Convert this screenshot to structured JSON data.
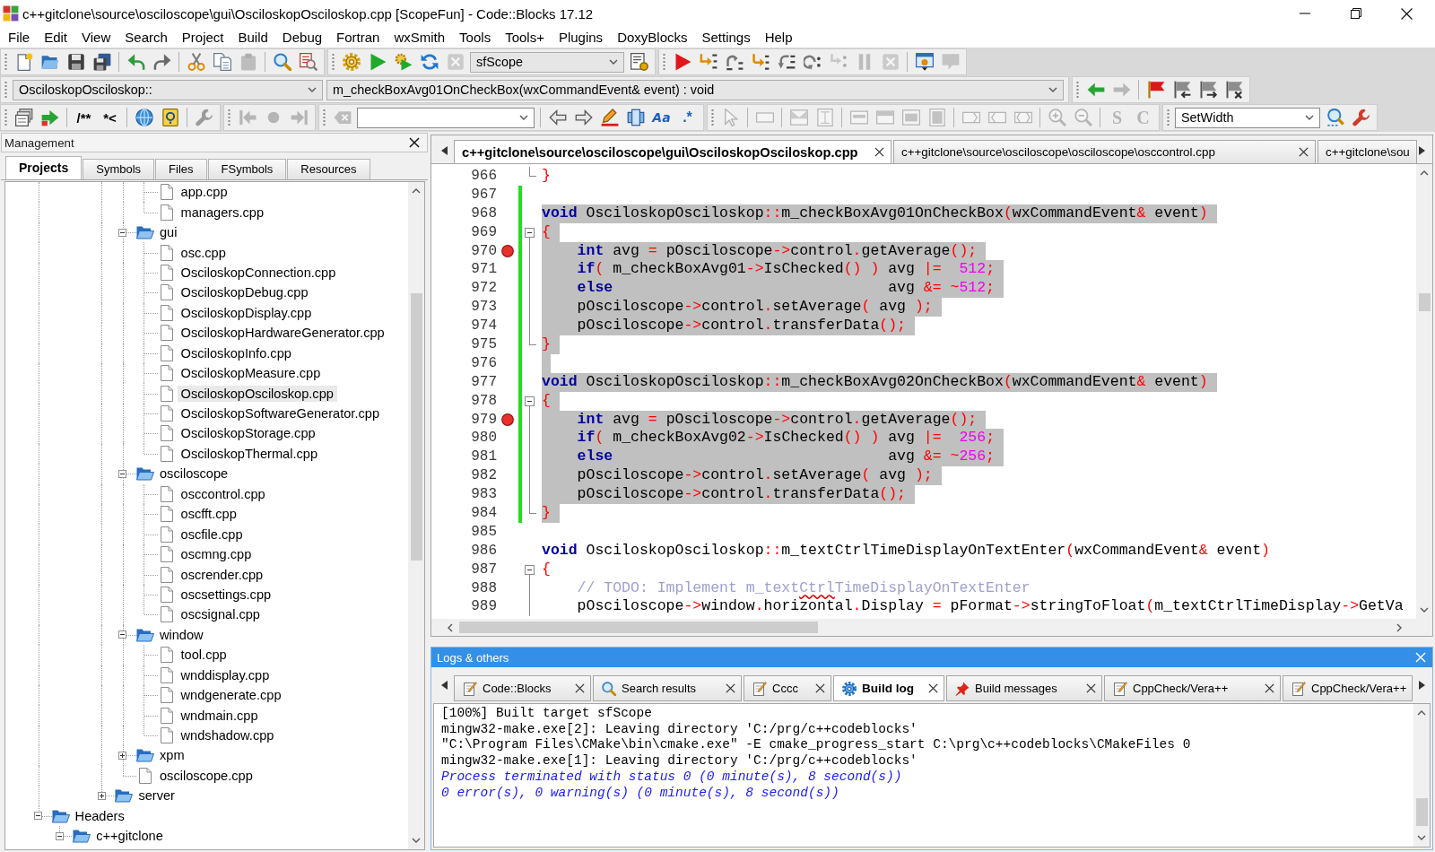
{
  "window": {
    "title": "c++gitclone\\source\\osciloscope\\gui\\OsciloskopOsciloskop.cpp [ScopeFun] - Code::Blocks 17.12"
  },
  "menu": [
    "File",
    "Edit",
    "View",
    "Search",
    "Project",
    "Build",
    "Debug",
    "Fortran",
    "wxSmith",
    "Tools",
    "Tools+",
    "Plugins",
    "DoxyBlocks",
    "Settings",
    "Help"
  ],
  "toolbar_rows": [
    {
      "toolbars": [
        {
          "items": [
            {
              "kind": "icon",
              "disabled": false
            },
            {
              "kind": "icon",
              "disabled": false
            },
            {
              "kind": "icon",
              "disabled": false
            },
            {
              "kind": "icon",
              "disabled": false
            },
            {
              "kind": "separator"
            },
            {
              "kind": "icon",
              "disabled": false
            },
            {
              "kind": "icon",
              "disabled": false
            },
            {
              "kind": "separator"
            },
            {
              "kind": "icon",
              "disabled": false
            },
            {
              "kind": "icon",
              "disabled": false
            },
            {
              "kind": "icon",
              "disabled": true
            },
            {
              "kind": "separator"
            },
            {
              "kind": "icon",
              "disabled": false
            },
            {
              "kind": "icon",
              "disabled": false
            }
          ]
        },
        {
          "items": [
            {
              "kind": "icon",
              "disabled": false
            },
            {
              "kind": "icon",
              "disabled": false
            },
            {
              "kind": "icon",
              "disabled": false
            },
            {
              "kind": "icon",
              "disabled": false
            },
            {
              "kind": "icon",
              "disabled": true
            },
            {
              "kind": "dropdown",
              "value": "sfScope",
              "disabled": false
            },
            {
              "kind": "icon",
              "disabled": false
            }
          ]
        },
        {
          "items": [
            {
              "kind": "icon",
              "disabled": false
            },
            {
              "kind": "icon",
              "disabled": false
            },
            {
              "kind": "icon",
              "disabled": false
            },
            {
              "kind": "icon",
              "disabled": false
            },
            {
              "kind": "icon",
              "disabled": false
            },
            {
              "kind": "icon",
              "disabled": false
            },
            {
              "kind": "icon",
              "disabled": true
            },
            {
              "kind": "icon",
              "disabled": true
            },
            {
              "kind": "icon",
              "disabled": true
            },
            {
              "kind": "separator"
            },
            {
              "kind": "icon",
              "disabled": false
            },
            {
              "kind": "icon",
              "disabled": true
            }
          ]
        }
      ]
    },
    {
      "toolbars": [
        {
          "items": [
            {
              "kind": "dropdown",
              "value": "OsciloskopOsciloskop::",
              "disabled": false
            },
            {
              "kind": "dropdown",
              "value": "m_checkBoxAvg01OnCheckBox(wxCommandEvent& event) : void",
              "disabled": false
            }
          ]
        },
        {
          "items": [
            {
              "kind": "icon",
              "disabled": false
            },
            {
              "kind": "icon",
              "disabled": true
            },
            {
              "kind": "separator"
            },
            {
              "kind": "icon",
              "disabled": false
            },
            {
              "kind": "icon",
              "disabled": false
            },
            {
              "kind": "icon",
              "disabled": false
            },
            {
              "kind": "icon",
              "disabled": false
            }
          ]
        }
      ]
    },
    {
      "toolbars": [
        {
          "items": [
            {
              "kind": "icon",
              "disabled": false
            },
            {
              "kind": "icon",
              "disabled": false
            },
            {
              "kind": "separator"
            },
            {
              "kind": "label",
              "text": "/**",
              "disabled": false
            },
            {
              "kind": "label",
              "text": "*<",
              "disabled": false
            },
            {
              "kind": "separator"
            },
            {
              "kind": "icon",
              "disabled": false
            },
            {
              "kind": "icon",
              "disabled": false
            },
            {
              "kind": "separator"
            },
            {
              "kind": "icon",
              "disabled": false
            }
          ]
        },
        {
          "items": [
            {
              "kind": "icon",
              "disabled": true
            },
            {
              "kind": "icon",
              "disabled": true
            },
            {
              "kind": "icon",
              "disabled": true
            }
          ]
        },
        {
          "items": [
            {
              "kind": "icon",
              "disabled": true
            },
            {
              "kind": "combo",
              "disabled": false
            },
            {
              "kind": "separator"
            },
            {
              "kind": "icon",
              "disabled": false
            },
            {
              "kind": "icon",
              "disabled": false
            },
            {
              "kind": "icon",
              "disabled": false
            },
            {
              "kind": "icon",
              "disabled": false
            },
            {
              "kind": "label",
              "text": "Aa",
              "disabled": false
            },
            {
              "kind": "label",
              "text": ".*",
              "disabled": false
            }
          ]
        },
        {
          "items": [
            {
              "kind": "icon",
              "disabled": true
            },
            {
              "kind": "separator"
            },
            {
              "kind": "icon",
              "disabled": true
            },
            {
              "kind": "separator"
            },
            {
              "kind": "icon",
              "disabled": true
            },
            {
              "kind": "icon",
              "disabled": true
            },
            {
              "kind": "separator"
            },
            {
              "kind": "icon",
              "disabled": true
            },
            {
              "kind": "icon",
              "disabled": true
            },
            {
              "kind": "icon",
              "disabled": true
            },
            {
              "kind": "icon",
              "disabled": true
            },
            {
              "kind": "separator"
            },
            {
              "kind": "icon",
              "disabled": true
            },
            {
              "kind": "icon",
              "disabled": true
            },
            {
              "kind": "icon",
              "disabled": true
            },
            {
              "kind": "separator"
            },
            {
              "kind": "icon",
              "disabled": true
            },
            {
              "kind": "icon",
              "disabled": true
            },
            {
              "kind": "separator"
            },
            {
              "kind": "label",
              "text": "S",
              "disabled": true
            },
            {
              "kind": "label",
              "text": "C",
              "disabled": true
            }
          ]
        },
        {
          "items": [
            {
              "kind": "combo",
              "value": "SetWidth",
              "disabled": false
            },
            {
              "kind": "icon",
              "disabled": false
            },
            {
              "kind": "icon",
              "disabled": false
            }
          ]
        }
      ]
    }
  ],
  "sidebar": {
    "title": "Management",
    "tabs": [
      {
        "label": "Projects",
        "selected": true
      },
      {
        "label": "Symbols",
        "selected": false
      },
      {
        "label": "Files",
        "selected": false
      },
      {
        "label": "FSymbols",
        "selected": false
      },
      {
        "label": "Resources",
        "selected": false
      }
    ],
    "tree": [
      {
        "children": [
          {
            "children": [
              {
                "children": [
                  {
                    "children": [
                      {
                        "children": [
                          {
                            "label": "app.cpp",
                            "kind": "file",
                            "selected": false
                          },
                          {
                            "label": "managers.cpp",
                            "kind": "file",
                            "selected": false
                          }
                        ]
                      },
                      {
                        "label": "gui",
                        "kind": "folder",
                        "expanded": true,
                        "selected": false,
                        "children": [
                          {
                            "label": "osc.cpp",
                            "kind": "file",
                            "selected": false
                          },
                          {
                            "label": "OsciloskopConnection.cpp",
                            "kind": "file",
                            "selected": false
                          },
                          {
                            "label": "OsciloskopDebug.cpp",
                            "kind": "file",
                            "selected": false
                          },
                          {
                            "label": "OsciloskopDisplay.cpp",
                            "kind": "file",
                            "selected": false
                          },
                          {
                            "label": "OsciloskopHardwareGenerator.cpp",
                            "kind": "file",
                            "selected": false
                          },
                          {
                            "label": "OsciloskopInfo.cpp",
                            "kind": "file",
                            "selected": false
                          },
                          {
                            "label": "OsciloskopMeasure.cpp",
                            "kind": "file",
                            "selected": false
                          },
                          {
                            "label": "OsciloskopOsciloskop.cpp",
                            "kind": "file",
                            "selected": true
                          },
                          {
                            "label": "OsciloskopSoftwareGenerator.cpp",
                            "kind": "file",
                            "selected": false
                          },
                          {
                            "label": "OsciloskopStorage.cpp",
                            "kind": "file",
                            "selected": false
                          },
                          {
                            "label": "OsciloskopThermal.cpp",
                            "kind": "file",
                            "selected": false
                          }
                        ]
                      },
                      {
                        "label": "osciloscope",
                        "kind": "folder",
                        "expanded": true,
                        "selected": false,
                        "children": [
                          {
                            "label": "osccontrol.cpp",
                            "kind": "file",
                            "selected": false
                          },
                          {
                            "label": "oscfft.cpp",
                            "kind": "file",
                            "selected": false
                          },
                          {
                            "label": "oscfile.cpp",
                            "kind": "file",
                            "selected": false
                          },
                          {
                            "label": "oscmng.cpp",
                            "kind": "file",
                            "selected": false
                          },
                          {
                            "label": "oscrender.cpp",
                            "kind": "file",
                            "selected": false
                          },
                          {
                            "label": "oscsettings.cpp",
                            "kind": "file",
                            "selected": false
                          },
                          {
                            "label": "oscsignal.cpp",
                            "kind": "file",
                            "selected": false
                          }
                        ]
                      },
                      {
                        "label": "window",
                        "kind": "folder",
                        "expanded": true,
                        "selected": false,
                        "children": [
                          {
                            "label": "tool.cpp",
                            "kind": "file",
                            "selected": false
                          },
                          {
                            "label": "wnddisplay.cpp",
                            "kind": "file",
                            "selected": false
                          },
                          {
                            "label": "wndgenerate.cpp",
                            "kind": "file",
                            "selected": false
                          },
                          {
                            "label": "wndmain.cpp",
                            "kind": "file",
                            "selected": false
                          },
                          {
                            "label": "wndshadow.cpp",
                            "kind": "file",
                            "selected": false
                          }
                        ]
                      },
                      {
                        "label": "xpm",
                        "kind": "folder",
                        "expanded": false,
                        "selected": false
                      },
                      {
                        "label": "osciloscope.cpp",
                        "kind": "file",
                        "selected": false
                      }
                    ]
                  },
                  {
                    "label": "server",
                    "kind": "folder",
                    "expanded": false,
                    "selected": false
                  }
                ]
              }
            ]
          }
        ]
      },
      {
        "label": "Headers",
        "kind": "folder",
        "expanded": true,
        "selected": false,
        "children": [
          {
            "label": "c++gitclone",
            "kind": "folder",
            "expanded": true,
            "selected": false
          }
        ]
      }
    ]
  },
  "editor": {
    "tabs": [
      {
        "label": "c++gitclone\\source\\osciloscope\\gui\\OsciloskopOsciloskop.cpp",
        "selected": true,
        "closable": true
      },
      {
        "label": "c++gitclone\\source\\osciloscope\\osciloscope\\osccontrol.cpp",
        "selected": false,
        "closable": true
      },
      {
        "label": "c++gitclone\\sou",
        "selected": false,
        "closable": false
      }
    ],
    "lines": [
      {
        "number": "966",
        "tokens": [
          {
            "kind": "operator",
            "text": "}"
          }
        ],
        "selected": false,
        "changed": false,
        "breakpoint": false,
        "fold_start": false,
        "fold_end": true
      },
      {
        "number": "967",
        "selected": false,
        "changed": true,
        "breakpoint": false,
        "fold_start": false,
        "fold_end": false
      },
      {
        "number": "968",
        "tokens": [
          {
            "kind": "keyword",
            "text": "void"
          },
          {
            "kind": "text",
            "text": " OsciloskopOsciloskop"
          },
          {
            "kind": "operator",
            "text": "::"
          },
          {
            "kind": "text",
            "text": "m_checkBoxAvg01OnCheckBox"
          },
          {
            "kind": "operator",
            "text": "("
          },
          {
            "kind": "text",
            "text": "wxCommandEvent"
          },
          {
            "kind": "operator",
            "text": "&"
          },
          {
            "kind": "text",
            "text": " event"
          },
          {
            "kind": "operator",
            "text": ")"
          }
        ],
        "selected": true,
        "changed": true,
        "breakpoint": false,
        "fold_start": false,
        "fold_end": false
      },
      {
        "number": "969",
        "tokens": [
          {
            "kind": "operator",
            "text": "{"
          }
        ],
        "selected": true,
        "changed": true,
        "breakpoint": false,
        "fold_start": true,
        "fold_end": false
      },
      {
        "number": "970",
        "tokens": [
          {
            "kind": "keyword",
            "text": "    int"
          },
          {
            "kind": "text",
            "text": " avg "
          },
          {
            "kind": "operator",
            "text": "="
          },
          {
            "kind": "text",
            "text": " pOsciloscope"
          },
          {
            "kind": "operator",
            "text": "->"
          },
          {
            "kind": "text",
            "text": "control"
          },
          {
            "kind": "operator",
            "text": "."
          },
          {
            "kind": "text",
            "text": "getAverage"
          },
          {
            "kind": "operator",
            "text": "();"
          }
        ],
        "selected": true,
        "changed": true,
        "breakpoint": true,
        "fold_start": false,
        "fold_end": false
      },
      {
        "number": "971",
        "tokens": [
          {
            "kind": "keyword",
            "text": "    if"
          },
          {
            "kind": "operator",
            "text": "("
          },
          {
            "kind": "text",
            "text": " m_checkBoxAvg01"
          },
          {
            "kind": "operator",
            "text": "->"
          },
          {
            "kind": "text",
            "text": "IsChecked"
          },
          {
            "kind": "operator",
            "text": "() )"
          },
          {
            "kind": "text",
            "text": " avg "
          },
          {
            "kind": "operator",
            "text": "|=  "
          },
          {
            "kind": "number",
            "text": "512"
          },
          {
            "kind": "operator",
            "text": ";"
          }
        ],
        "selected": true,
        "changed": true,
        "breakpoint": false,
        "fold_start": false,
        "fold_end": false
      },
      {
        "number": "972",
        "tokens": [
          {
            "kind": "keyword",
            "text": "    else"
          },
          {
            "kind": "text",
            "text": "                               avg "
          },
          {
            "kind": "operator",
            "text": "&= ~"
          },
          {
            "kind": "number",
            "text": "512"
          },
          {
            "kind": "operator",
            "text": ";"
          }
        ],
        "selected": true,
        "changed": true,
        "breakpoint": false,
        "fold_start": false,
        "fold_end": false
      },
      {
        "number": "973",
        "tokens": [
          {
            "kind": "text",
            "text": "    pOsciloscope"
          },
          {
            "kind": "operator",
            "text": "->"
          },
          {
            "kind": "text",
            "text": "control"
          },
          {
            "kind": "operator",
            "text": "."
          },
          {
            "kind": "text",
            "text": "setAverage"
          },
          {
            "kind": "operator",
            "text": "("
          },
          {
            "kind": "text",
            "text": " avg "
          },
          {
            "kind": "operator",
            "text": ");"
          }
        ],
        "selected": true,
        "changed": true,
        "breakpoint": false,
        "fold_start": false,
        "fold_end": false
      },
      {
        "number": "974",
        "tokens": [
          {
            "kind": "text",
            "text": "    pOsciloscope"
          },
          {
            "kind": "operator",
            "text": "->"
          },
          {
            "kind": "text",
            "text": "control"
          },
          {
            "kind": "operator",
            "text": "."
          },
          {
            "kind": "text",
            "text": "transferData"
          },
          {
            "kind": "operator",
            "text": "();"
          }
        ],
        "selected": true,
        "changed": true,
        "breakpoint": false,
        "fold_start": false,
        "fold_end": false
      },
      {
        "number": "975",
        "tokens": [
          {
            "kind": "operator",
            "text": "}"
          }
        ],
        "selected": true,
        "changed": true,
        "breakpoint": false,
        "fold_start": false,
        "fold_end": true
      },
      {
        "number": "976",
        "selected": true,
        "changed": true,
        "breakpoint": false,
        "fold_start": false,
        "fold_end": false
      },
      {
        "number": "977",
        "tokens": [
          {
            "kind": "keyword",
            "text": "void"
          },
          {
            "kind": "text",
            "text": " OsciloskopOsciloskop"
          },
          {
            "kind": "operator",
            "text": "::"
          },
          {
            "kind": "text",
            "text": "m_checkBoxAvg02OnCheckBox"
          },
          {
            "kind": "operator",
            "text": "("
          },
          {
            "kind": "text",
            "text": "wxCommandEvent"
          },
          {
            "kind": "operator",
            "text": "&"
          },
          {
            "kind": "text",
            "text": " event"
          },
          {
            "kind": "operator",
            "text": ")"
          }
        ],
        "selected": true,
        "changed": true,
        "breakpoint": false,
        "fold_start": false,
        "fold_end": false
      },
      {
        "number": "978",
        "tokens": [
          {
            "kind": "operator",
            "text": "{"
          }
        ],
        "selected": true,
        "changed": true,
        "breakpoint": false,
        "fold_start": true,
        "fold_end": false
      },
      {
        "number": "979",
        "tokens": [
          {
            "kind": "keyword",
            "text": "    int"
          },
          {
            "kind": "text",
            "text": " avg "
          },
          {
            "kind": "operator",
            "text": "="
          },
          {
            "kind": "text",
            "text": " pOsciloscope"
          },
          {
            "kind": "operator",
            "text": "->"
          },
          {
            "kind": "text",
            "text": "control"
          },
          {
            "kind": "operator",
            "text": "."
          },
          {
            "kind": "text",
            "text": "getAverage"
          },
          {
            "kind": "operator",
            "text": "();"
          }
        ],
        "selected": true,
        "changed": true,
        "breakpoint": true,
        "fold_start": false,
        "fold_end": false
      },
      {
        "number": "980",
        "tokens": [
          {
            "kind": "keyword",
            "text": "    if"
          },
          {
            "kind": "operator",
            "text": "("
          },
          {
            "kind": "text",
            "text": " m_checkBoxAvg02"
          },
          {
            "kind": "operator",
            "text": "->"
          },
          {
            "kind": "text",
            "text": "IsChecked"
          },
          {
            "kind": "operator",
            "text": "() )"
          },
          {
            "kind": "text",
            "text": " avg "
          },
          {
            "kind": "operator",
            "text": "|=  "
          },
          {
            "kind": "number",
            "text": "256"
          },
          {
            "kind": "operator",
            "text": ";"
          }
        ],
        "selected": true,
        "changed": true,
        "breakpoint": false,
        "fold_start": false,
        "fold_end": false
      },
      {
        "number": "981",
        "tokens": [
          {
            "kind": "keyword",
            "text": "    else"
          },
          {
            "kind": "text",
            "text": "                               avg "
          },
          {
            "kind": "operator",
            "text": "&= ~"
          },
          {
            "kind": "number",
            "text": "256"
          },
          {
            "kind": "operator",
            "text": ";"
          }
        ],
        "selected": true,
        "changed": true,
        "breakpoint": false,
        "fold_start": false,
        "fold_end": false
      },
      {
        "number": "982",
        "tokens": [
          {
            "kind": "text",
            "text": "    pOsciloscope"
          },
          {
            "kind": "operator",
            "text": "->"
          },
          {
            "kind": "text",
            "text": "control"
          },
          {
            "kind": "operator",
            "text": "."
          },
          {
            "kind": "text",
            "text": "setAverage"
          },
          {
            "kind": "operator",
            "text": "("
          },
          {
            "kind": "text",
            "text": " avg "
          },
          {
            "kind": "operator",
            "text": ");"
          }
        ],
        "selected": true,
        "changed": true,
        "breakpoint": false,
        "fold_start": false,
        "fold_end": false
      },
      {
        "number": "983",
        "tokens": [
          {
            "kind": "text",
            "text": "    pOsciloscope"
          },
          {
            "kind": "operator",
            "text": "->"
          },
          {
            "kind": "text",
            "text": "control"
          },
          {
            "kind": "operator",
            "text": "."
          },
          {
            "kind": "text",
            "text": "transferData"
          },
          {
            "kind": "operator",
            "text": "();"
          }
        ],
        "selected": true,
        "changed": true,
        "breakpoint": false,
        "fold_start": false,
        "fold_end": false
      },
      {
        "number": "984",
        "tokens": [
          {
            "kind": "operator",
            "text": "}"
          }
        ],
        "selected": true,
        "changed": true,
        "breakpoint": false,
        "fold_start": false,
        "fold_end": true
      },
      {
        "number": "985",
        "selected": false,
        "changed": false,
        "breakpoint": false,
        "fold_start": false,
        "fold_end": false
      },
      {
        "number": "986",
        "tokens": [
          {
            "kind": "keyword",
            "text": "void"
          },
          {
            "kind": "text",
            "text": " OsciloskopOsciloskop"
          },
          {
            "kind": "operator",
            "text": "::"
          },
          {
            "kind": "text",
            "text": "m_textCtrlTimeDisplayOnTextEnter"
          },
          {
            "kind": "operator",
            "text": "("
          },
          {
            "kind": "text",
            "text": "wxCommandEvent"
          },
          {
            "kind": "operator",
            "text": "&"
          },
          {
            "kind": "text",
            "text": " event"
          },
          {
            "kind": "operator",
            "text": ")"
          }
        ],
        "selected": false,
        "changed": false,
        "breakpoint": false,
        "fold_start": false,
        "fold_end": false
      },
      {
        "number": "987",
        "tokens": [
          {
            "kind": "operator",
            "text": "{"
          }
        ],
        "selected": false,
        "changed": false,
        "breakpoint": false,
        "fold_start": true,
        "fold_end": false
      },
      {
        "number": "988",
        "tokens": [
          {
            "kind": "comment",
            "text": "    // TODO: Implement m_text"
          },
          {
            "kind": "misspelled",
            "text": "Ctrl"
          },
          {
            "kind": "comment",
            "text": "TimeDisplayOnTextEnter"
          }
        ],
        "selected": false,
        "changed": false,
        "breakpoint": false,
        "fold_start": false,
        "fold_end": false
      },
      {
        "number": "989",
        "tokens": [
          {
            "kind": "text",
            "text": "    pOsciloscope"
          },
          {
            "kind": "operator",
            "text": "->"
          },
          {
            "kind": "text",
            "text": "window"
          },
          {
            "kind": "operator",
            "text": "."
          },
          {
            "kind": "text",
            "text": "horizontal"
          },
          {
            "kind": "operator",
            "text": "."
          },
          {
            "kind": "text",
            "text": "Display "
          },
          {
            "kind": "operator",
            "text": "="
          },
          {
            "kind": "text",
            "text": " pFormat"
          },
          {
            "kind": "operator",
            "text": "->"
          },
          {
            "kind": "text",
            "text": "stringToFloat"
          },
          {
            "kind": "operator",
            "text": "("
          },
          {
            "kind": "text",
            "text": "m_textCtrlTimeDisplay"
          },
          {
            "kind": "operator",
            "text": "->"
          },
          {
            "kind": "text",
            "text": "GetVa"
          }
        ],
        "selected": false,
        "changed": false,
        "breakpoint": false,
        "fold_start": false,
        "fold_end": false
      }
    ]
  },
  "logs": {
    "title": "Logs & others",
    "tabs": [
      {
        "label": "Code::Blocks",
        "kind": "log",
        "selected": false,
        "closable": true
      },
      {
        "label": "Search results",
        "kind": "search",
        "selected": false,
        "closable": true
      },
      {
        "label": "Cccc",
        "kind": "log",
        "selected": false,
        "closable": true
      },
      {
        "label": "Build log",
        "kind": "build",
        "selected": true,
        "closable": true
      },
      {
        "label": "Build messages",
        "kind": "messages",
        "selected": false,
        "closable": true
      },
      {
        "label": "CppCheck/Vera++",
        "kind": "log",
        "selected": false,
        "closable": true
      },
      {
        "label": "CppCheck/Vera++",
        "kind": "log",
        "selected": false,
        "closable": false
      }
    ],
    "lines": [
      {
        "kind": "output",
        "text": "[100%] Built target sfScope"
      },
      {
        "kind": "output",
        "text": "mingw32-make.exe[2]: Leaving directory 'C:/prg/c++codeblocks'"
      },
      {
        "kind": "output",
        "text": "\"C:\\Program Files\\CMake\\bin\\cmake.exe\" -E cmake_progress_start C:\\prg\\c++codeblocks\\CMakeFiles 0"
      },
      {
        "kind": "output",
        "text": "mingw32-make.exe[1]: Leaving directory 'C:/prg/c++codeblocks'"
      },
      {
        "kind": "status",
        "text": "Process terminated with status 0 (0 minute(s), 8 second(s))"
      },
      {
        "kind": "status",
        "text": "0 error(s), 0 warning(s) (0 minute(s), 8 second(s))"
      }
    ]
  }
}
